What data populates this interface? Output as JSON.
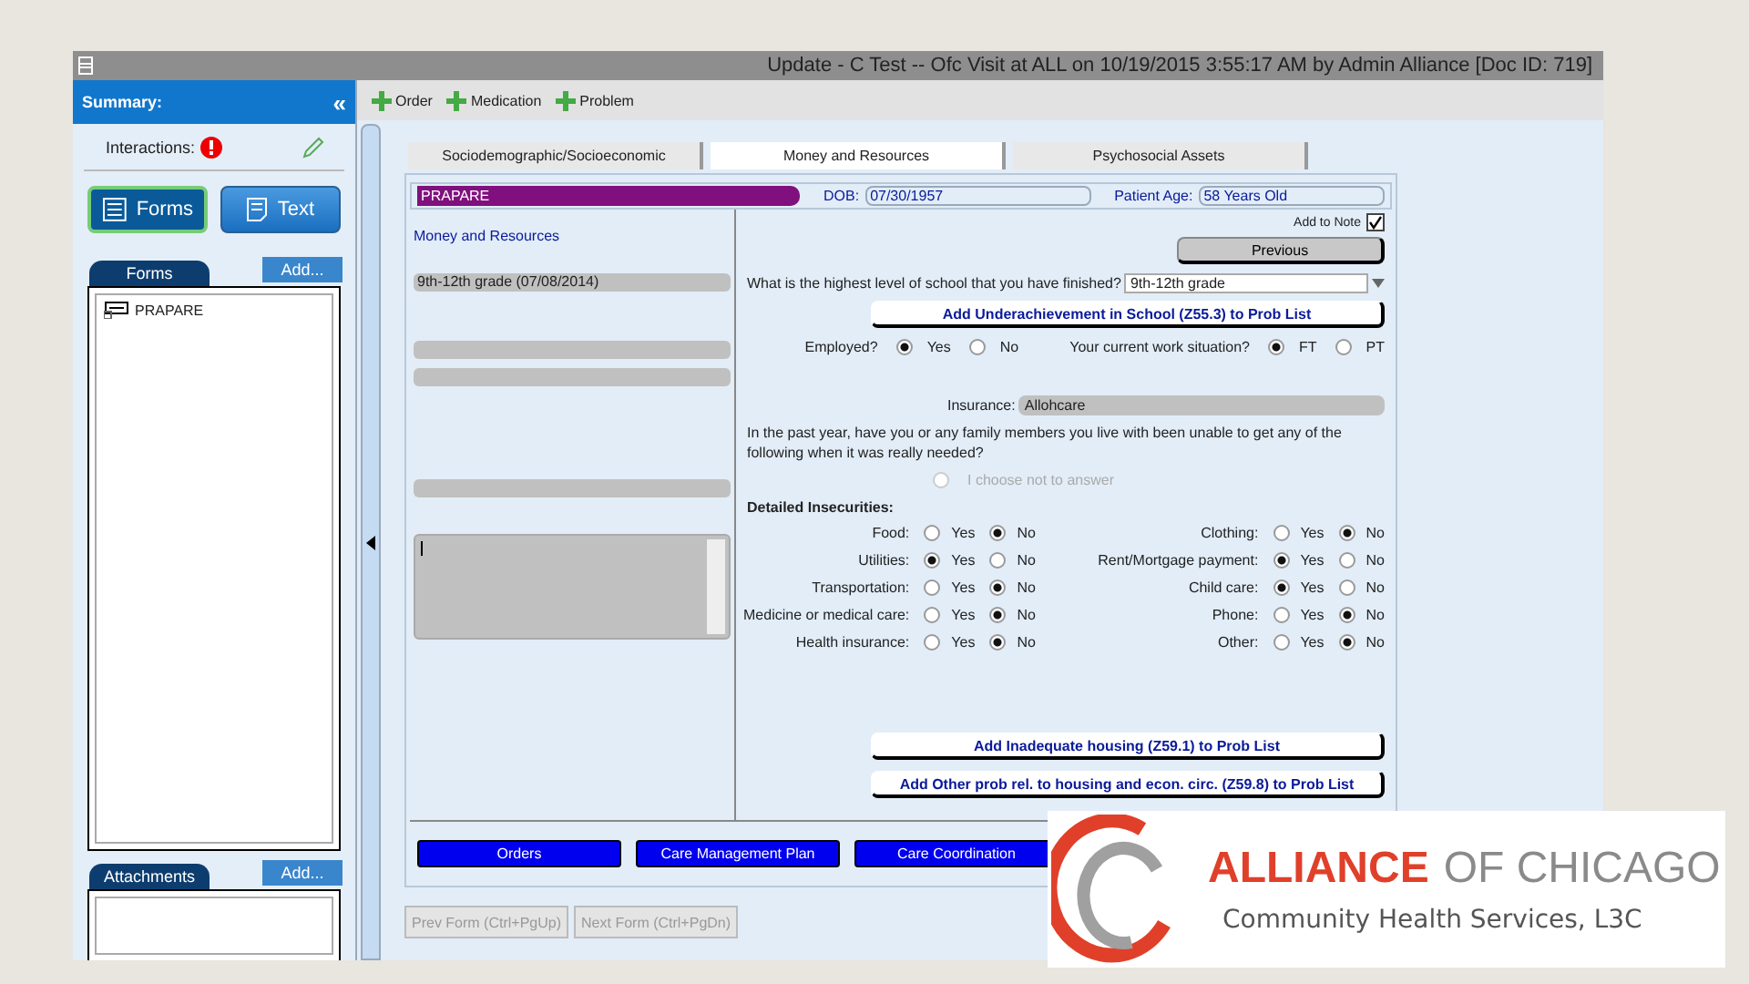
{
  "window": {
    "title": "Update - C Test -- Ofc Visit at ALL on 10/19/2015 3:55:17 AM by Admin  Alliance [Doc ID: 719]"
  },
  "sidebar": {
    "title": "Summary:",
    "collapse": "«",
    "interactions_label": "Interactions:",
    "view_buttons": [
      {
        "label": "Forms",
        "kind": "list",
        "selected": true
      },
      {
        "label": "Text",
        "kind": "doc",
        "selected": false
      }
    ],
    "forms_tab": "Forms",
    "forms_add": "Add...",
    "forms": [
      "PRAPARE"
    ],
    "attachments_tab": "Attachments",
    "attachments_add": "Add..."
  },
  "toolbar": [
    "Order",
    "Medication",
    "Problem"
  ],
  "tabs": [
    {
      "label": "Sociodemographic/Socioeconomic",
      "selected": false
    },
    {
      "label": "Money and Resources",
      "selected": true
    },
    {
      "label": "Psychosocial Assets",
      "selected": false
    }
  ],
  "header": {
    "form_name": "PRAPARE",
    "dob_label": "DOB:",
    "dob": "07/30/1957",
    "age_label": "Patient Age:",
    "age": "58 Years Old"
  },
  "left_panel": {
    "heading": "Money and Resources",
    "fields": [
      {
        "kind": "text",
        "value": "9th-12th grade (07/08/2014)"
      },
      {
        "kind": "blank"
      },
      {
        "kind": "blank"
      },
      {
        "kind": "blank"
      },
      {
        "kind": "memo"
      }
    ]
  },
  "add_to_note": {
    "label": "Add to Note",
    "checked": true
  },
  "previous": "Previous",
  "school": {
    "question": "What is the highest level of school that you have finished?",
    "value": "9th-12th grade"
  },
  "school_button": "Add Underachievement in School (Z55.3) to Prob List",
  "employment": [
    {
      "label": "Employed?",
      "options": [
        {
          "label": "Yes",
          "selected": true
        },
        {
          "label": "No",
          "selected": false
        }
      ]
    },
    {
      "label": "Your current work situation?",
      "options": [
        {
          "label": "FT",
          "selected": true
        },
        {
          "label": "PT",
          "selected": false
        }
      ]
    }
  ],
  "insurance": {
    "label": "Insurance:",
    "value": "Allohcare"
  },
  "unable_question": "In the past year, have you or any family members you live with been unable to get any of the following when it was really needed?",
  "choose_not": {
    "label": "I choose not to answer",
    "selected": false
  },
  "insecurities_title": "Detailed Insecurities:",
  "insecurities": [
    [
      {
        "label": "Food:",
        "options": [
          {
            "label": "Yes",
            "selected": false
          },
          {
            "label": "No",
            "selected": true
          }
        ]
      },
      {
        "label": "Utilities:",
        "options": [
          {
            "label": "Yes",
            "selected": true
          },
          {
            "label": "No",
            "selected": false
          }
        ]
      },
      {
        "label": "Transportation:",
        "options": [
          {
            "label": "Yes",
            "selected": false
          },
          {
            "label": "No",
            "selected": true
          }
        ]
      },
      {
        "label": "Medicine or medical care:",
        "options": [
          {
            "label": "Yes",
            "selected": false
          },
          {
            "label": "No",
            "selected": true
          }
        ]
      },
      {
        "label": "Health insurance:",
        "options": [
          {
            "label": "Yes",
            "selected": false
          },
          {
            "label": "No",
            "selected": true
          }
        ]
      }
    ],
    [
      {
        "label": "Clothing:",
        "options": [
          {
            "label": "Yes",
            "selected": false
          },
          {
            "label": "No",
            "selected": true
          }
        ]
      },
      {
        "label": "Rent/Mortgage payment:",
        "options": [
          {
            "label": "Yes",
            "selected": true
          },
          {
            "label": "No",
            "selected": false
          }
        ]
      },
      {
        "label": "Child care:",
        "options": [
          {
            "label": "Yes",
            "selected": true
          },
          {
            "label": "No",
            "selected": false
          }
        ]
      },
      {
        "label": "Phone:",
        "options": [
          {
            "label": "Yes",
            "selected": false
          },
          {
            "label": "No",
            "selected": true
          }
        ]
      },
      {
        "label": "Other:",
        "options": [
          {
            "label": "Yes",
            "selected": false
          },
          {
            "label": "No",
            "selected": true
          }
        ]
      }
    ]
  ],
  "housing_buttons": [
    "Add Inadequate housing (Z59.1) to Prob List",
    "Add Other prob rel. to housing and econ. circ. (Z59.8) to Prob List"
  ],
  "bottom_buttons": [
    "Orders",
    "Care Management Plan",
    "Care Coordination"
  ],
  "nav": [
    "Prev Form (Ctrl+PgUp)",
    "Next Form (Ctrl+PgDn)"
  ],
  "logo": {
    "name": "ALLIANCE",
    "name2": "OF CHICAGO",
    "subtitle": "Community Health Services, L3C"
  }
}
